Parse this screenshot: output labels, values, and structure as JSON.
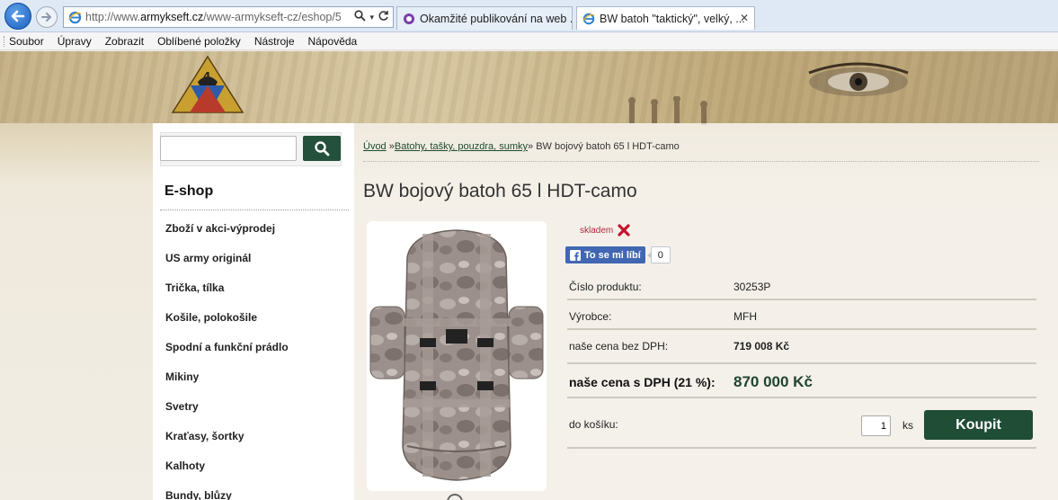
{
  "browser": {
    "address_prefix": "http://www.",
    "address_domain": "armykseft.cz",
    "address_path": "/www-armykseft-cz/eshop/5",
    "tabs": [
      {
        "label": "Okamžité publikování na web ..."
      },
      {
        "label": "BW batoh \"taktický\", velký, ..."
      }
    ],
    "menu": [
      "Soubor",
      "Úpravy",
      "Zobrazit",
      "Oblíbené položky",
      "Nástroje",
      "Nápověda"
    ]
  },
  "sidebar": {
    "search_placeholder": "",
    "heading": "E-shop",
    "categories": [
      "Zboží v akci-výprodej",
      "US army originál",
      "Trička, tílka",
      "Košile, polokošile",
      "Spodní a funkční prádlo",
      "Mikiny",
      "Svetry",
      "Kraťasy, šortky",
      "Kalhoty",
      "Bundy, blůzy"
    ]
  },
  "breadcrumb": {
    "home": "Úvod",
    "sep1": " »",
    "category": "Batohy, tašky, pouzdra, sumky",
    "sep2": "» ",
    "current": "BW bojový batoh 65 l HDT-camo"
  },
  "product": {
    "title": "BW bojový batoh 65 l HDT-camo",
    "availability": "skladem",
    "fb_like_label": "To se mi líbí",
    "fb_like_count": "0",
    "specs": {
      "code_label": "Číslo produktu:",
      "code_value": "30253P",
      "maker_label": "Výrobce:",
      "maker_value": "MFH",
      "price_net_label": "naše cena bez DPH:",
      "price_net_value": "719 008 Kč",
      "price_gross_label": "naše cena s DPH (21 %):",
      "price_gross_value": "870 000 Kč",
      "cart_label": "do košíku:"
    },
    "quantity": "1",
    "quantity_unit": "ks",
    "buy_label": "Koupit"
  },
  "colors": {
    "accent_green": "#24513b",
    "price_green": "#1e4530",
    "availability_red": "#b0283b"
  }
}
